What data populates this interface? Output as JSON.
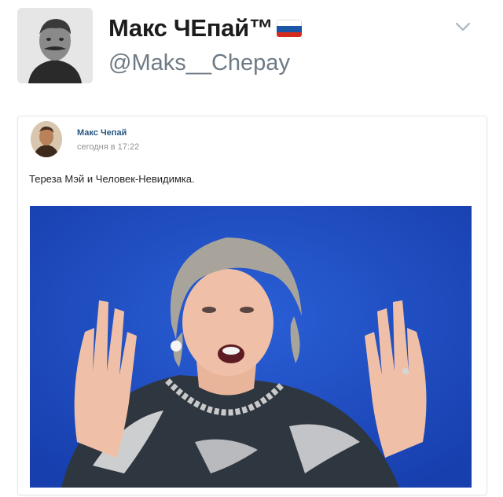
{
  "tweet": {
    "display_name": "Макс ЧЕпай™",
    "handle": "@Maks__Chepay",
    "flag_colors": [
      "#ffffff",
      "#1c57a5",
      "#d52b1e"
    ],
    "avatar_icon": "portrait-photo",
    "menu_icon": "chevron-down-icon"
  },
  "embed": {
    "author": "Макс Чепай",
    "timestamp": "сегодня в 17:22",
    "text": "Тереза Мэй и Человек-Невидимка.",
    "photo_background": "#2152c4"
  }
}
